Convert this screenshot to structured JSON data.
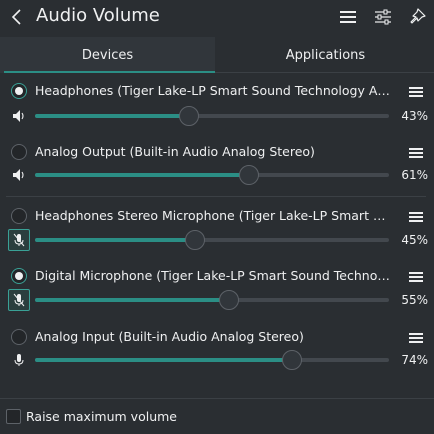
{
  "header": {
    "title": "Audio Volume"
  },
  "tabs": [
    {
      "label": "Devices",
      "active": true
    },
    {
      "label": "Applications",
      "active": false
    }
  ],
  "devices": [
    {
      "name": "Headphones (Tiger Lake-LP Smart Sound Technology Audio Controller Speaker + Headphones)",
      "percent_label": "43%",
      "volume": 43,
      "selected": true,
      "type": "output"
    },
    {
      "name": "Analog Output (Built-in Audio Analog Stereo)",
      "percent_label": "61%",
      "volume": 61,
      "selected": false,
      "type": "output"
    },
    {
      "name": "Headphones Stereo Microphone (Tiger Lake-LP Smart Sound Technology Audio Controller Headphones Stereo Microphone)",
      "percent_label": "45%",
      "volume": 45,
      "selected": false,
      "type": "input",
      "muted_box": true
    },
    {
      "name": "Digital Microphone (Tiger Lake-LP Smart Sound Technology Audio Controller Digital Microphone)",
      "percent_label": "55%",
      "volume": 55,
      "selected": true,
      "type": "input",
      "muted_box": true
    },
    {
      "name": "Analog Input (Built-in Audio Analog Stereo)",
      "percent_label": "74%",
      "volume": 74,
      "selected": false,
      "type": "input"
    }
  ],
  "footer": {
    "raise_max_label": "Raise maximum volume",
    "raise_max_checked": false
  },
  "colors": {
    "background": "#2a2e32",
    "accent": "#2b8e85",
    "text": "#eff0f1"
  }
}
